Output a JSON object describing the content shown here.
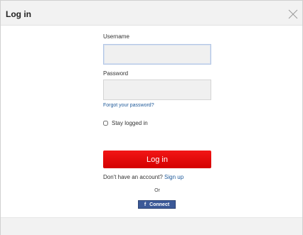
{
  "dialog": {
    "title": "Log in",
    "close_icon": "close-icon"
  },
  "form": {
    "username_label": "Username",
    "username_value": "",
    "password_label": "Password",
    "password_value": "",
    "forgot_link": "Forgot your password?",
    "stay_logged_in_label": "Stay logged in",
    "stay_logged_in_checked": false,
    "submit_label": "Log in"
  },
  "signup": {
    "prompt": "Don't have an account?",
    "link": "Sign up"
  },
  "separator": "Or",
  "facebook": {
    "icon": "facebook-icon",
    "icon_glyph": "f",
    "label": "Connect",
    "color": "#3b5998"
  },
  "colors": {
    "primary_button": "#e60000",
    "link": "#1f5a9a",
    "header_bg": "#f2f2f2"
  }
}
